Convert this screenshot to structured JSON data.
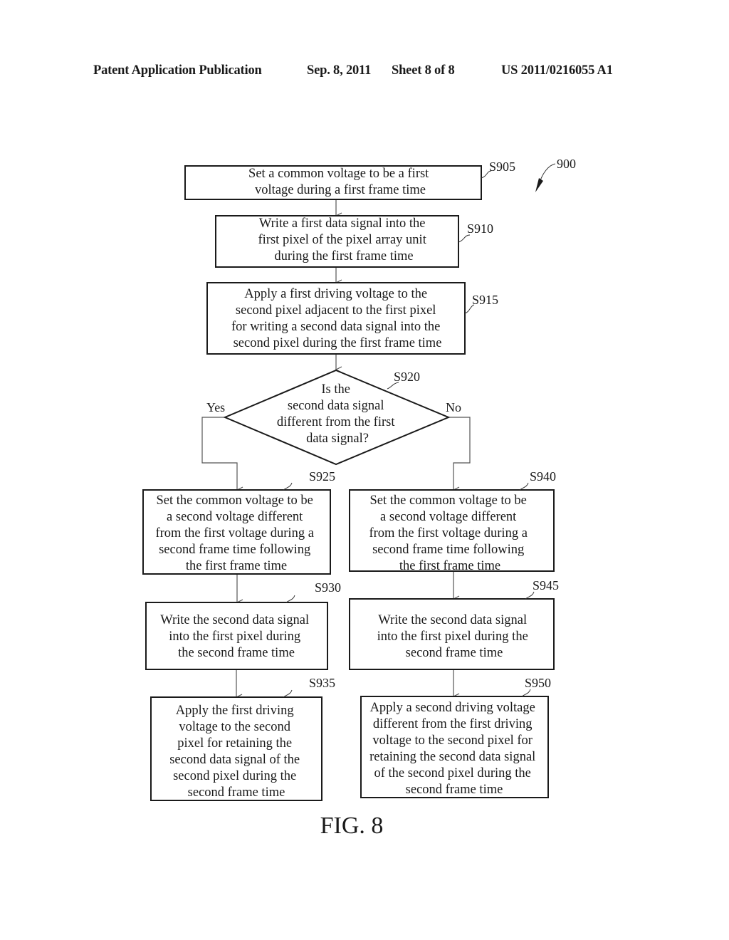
{
  "header": {
    "publication": "Patent Application Publication",
    "date": "Sep. 8, 2011",
    "sheet": "Sheet 8 of 8",
    "number": "US 2011/0216055 A1"
  },
  "figure": {
    "ref": "900",
    "caption": "FIG. 8",
    "steps": {
      "s905": {
        "id": "S905",
        "lines": [
          "Set a common voltage to be a first",
          "voltage during a first frame time"
        ]
      },
      "s910": {
        "id": "S910",
        "lines": [
          "Write a first data signal into the",
          "first pixel of the pixel array unit",
          "during the first frame time"
        ]
      },
      "s915": {
        "id": "S915",
        "lines": [
          "Apply a first driving voltage to the",
          "second pixel adjacent to the first pixel",
          "for writing a second data signal into the",
          "second pixel during the first frame time"
        ]
      },
      "s920": {
        "id": "S920",
        "lines": [
          "Is the",
          "second data signal",
          "different from the first",
          "data signal?"
        ],
        "yes": "Yes",
        "no": "No"
      },
      "s925": {
        "id": "S925",
        "lines": [
          "Set the common voltage to be",
          "a second voltage different",
          "from the first voltage during a",
          "second frame time following",
          "the first frame time"
        ]
      },
      "s930": {
        "id": "S930",
        "lines": [
          "Write the second data signal",
          "into the first pixel during",
          "the second frame time"
        ]
      },
      "s935": {
        "id": "S935",
        "lines": [
          "Apply the first driving",
          "voltage to the second",
          "pixel for retaining the",
          "second data signal of the",
          "second pixel during the",
          "second frame time"
        ]
      },
      "s940": {
        "id": "S940",
        "lines": [
          "Set the common voltage to be",
          "a second voltage different",
          "from the first voltage during a",
          "second frame time following",
          "the first frame time"
        ]
      },
      "s945": {
        "id": "S945",
        "lines": [
          "Write the second data signal",
          "into the first pixel during the",
          "second frame time"
        ]
      },
      "s950": {
        "id": "S950",
        "lines": [
          "Apply a second driving voltage",
          "different from the first driving",
          "voltage to the second pixel for",
          "retaining the second data signal",
          "of the second pixel during the",
          "second frame time"
        ]
      }
    }
  }
}
